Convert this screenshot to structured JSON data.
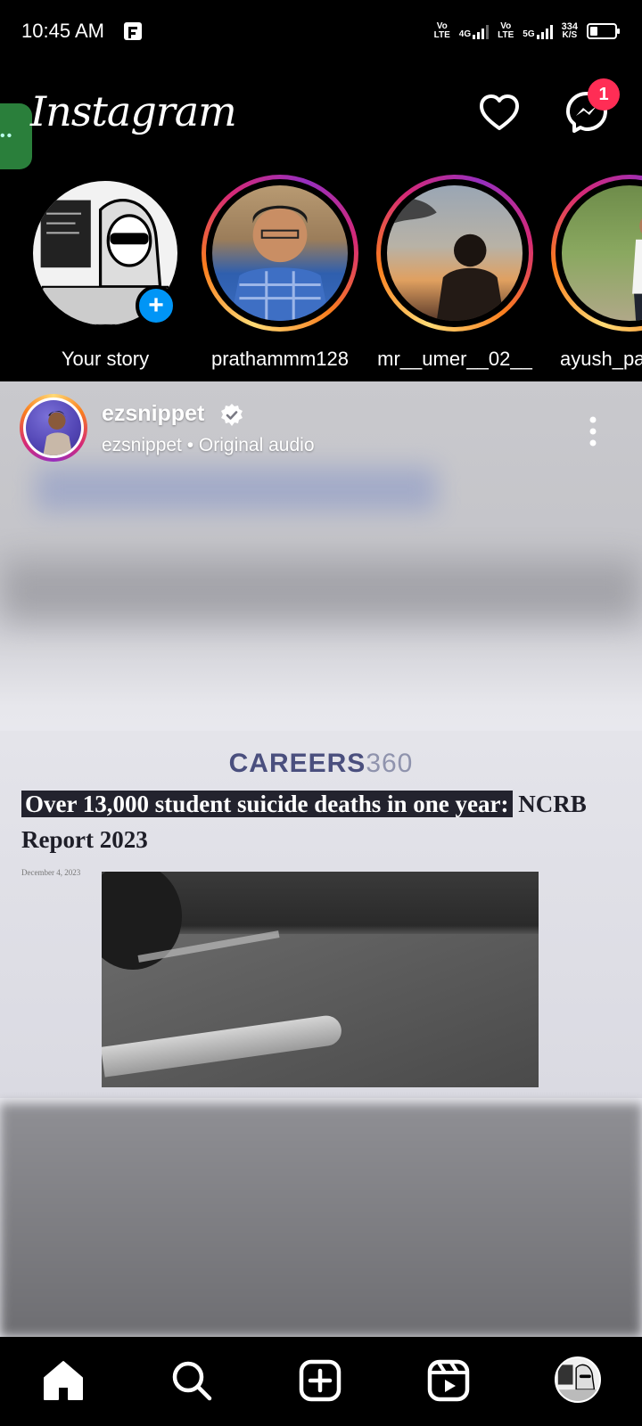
{
  "status_bar": {
    "time": "10:45 AM",
    "net1_top": "Vo",
    "net1_bottom": "LTE",
    "net1_gen": "4G",
    "net2_top": "Vo",
    "net2_bottom": "LTE",
    "net2_gen": "5G",
    "speed_value": "334",
    "speed_unit": "K/S",
    "battery_level_fraction": 0.4
  },
  "header": {
    "logo": "Instagram",
    "side_tab_label": "••",
    "heart_icon": "heart-icon",
    "messenger_icon": "messenger-icon",
    "messenger_badge": "1"
  },
  "stories": [
    {
      "name": "Your story",
      "has_add": true
    },
    {
      "name": "prathammm128"
    },
    {
      "name": "mr__umer__02__"
    },
    {
      "name": "ayush_pa"
    }
  ],
  "post": {
    "username": "ezsnippet",
    "audio": "ezsnippet • Original audio",
    "brand_word": "CAREERS",
    "brand_number": "360",
    "headline_highlight": "Over 13,000 student suicide deaths in one year:",
    "headline_rest": " NCRB Report 2023",
    "dateline": "December 4, 2023"
  },
  "colors": {
    "accent_blue": "#0095f6",
    "badge_red": "#ff2d55",
    "background": "#000000"
  },
  "nav": [
    "home-icon",
    "search-icon",
    "create-icon",
    "reels-icon",
    "profile-avatar"
  ]
}
